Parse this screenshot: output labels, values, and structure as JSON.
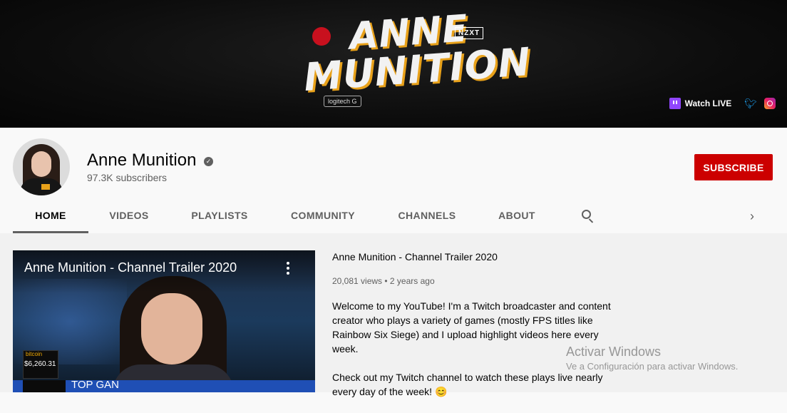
{
  "banner": {
    "logo_line1": "ANNE",
    "logo_line2": "MUNITION",
    "sponsors": [
      "NZXT",
      "logitech G"
    ],
    "links": {
      "watch_live": "Watch LIVE"
    }
  },
  "channel": {
    "name": "Anne Munition",
    "subscribers": "97.3K subscribers",
    "subscribe_label": "SUBSCRIBE"
  },
  "tabs": [
    "HOME",
    "VIDEOS",
    "PLAYLISTS",
    "COMMUNITY",
    "CHANNELS",
    "ABOUT"
  ],
  "active_tab": "HOME",
  "featured": {
    "player_title": "Anne Munition - Channel Trailer 2020",
    "title": "Anne Munition - Channel Trailer 2020",
    "views": "20,081 views",
    "age": "2 years ago",
    "description_p1": "Welcome to my YouTube! I'm a Twitch broadcaster and content creator who plays a variety of games (mostly FPS titles like Rainbow Six Siege) and I upload highlight videos here every week.",
    "description_p2": "Check out my Twitch channel to watch these plays live nearly every day of the week! 😊",
    "overlay": {
      "bitcoin_label": "bitcoin",
      "bitcoin_value": "$6,260.31",
      "lower_third": "TOP GAN"
    }
  },
  "watermark": {
    "line1": "Activar Windows",
    "line2": "Ve a Configuración para activar Windows."
  },
  "colors": {
    "subscribe": "#cc0000",
    "twitch": "#9146ff",
    "twitter": "#1da1f2"
  }
}
